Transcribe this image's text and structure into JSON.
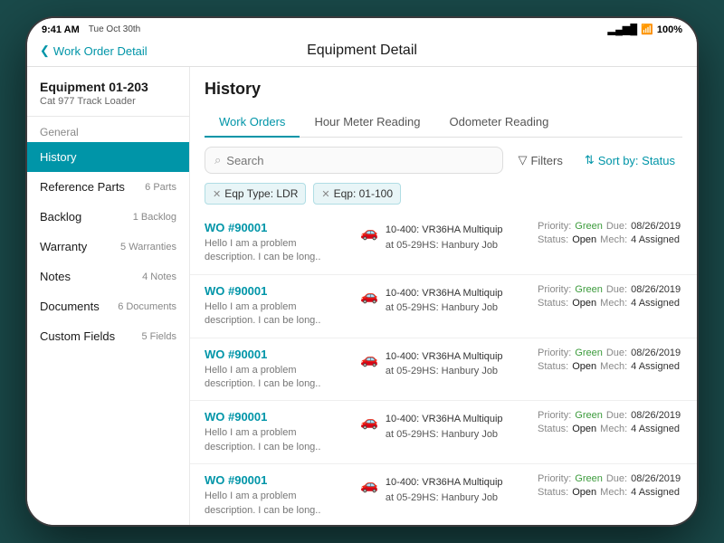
{
  "device": {
    "status_bar": {
      "time": "9:41 AM",
      "date": "Tue Oct 30th",
      "battery": "100%"
    },
    "nav": {
      "back_label": "Work Order Detail",
      "title": "Equipment Detail"
    }
  },
  "sidebar": {
    "equipment_id": "Equipment 01-203",
    "equipment_name": "Cat 977 Track Loader",
    "section_label": "General",
    "items": [
      {
        "id": "history",
        "label": "History",
        "badge": "",
        "active": true
      },
      {
        "id": "reference-parts",
        "label": "Reference Parts",
        "badge": "6 Parts",
        "active": false
      },
      {
        "id": "backlog",
        "label": "Backlog",
        "badge": "1 Backlog",
        "active": false
      },
      {
        "id": "warranty",
        "label": "Warranty",
        "badge": "5 Warranties",
        "active": false
      },
      {
        "id": "notes",
        "label": "Notes",
        "badge": "4 Notes",
        "active": false
      },
      {
        "id": "documents",
        "label": "Documents",
        "badge": "6 Documents",
        "active": false
      },
      {
        "id": "custom-fields",
        "label": "Custom Fields",
        "badge": "5 Fields",
        "active": false
      }
    ]
  },
  "content": {
    "title": "History",
    "tabs": [
      {
        "id": "work-orders",
        "label": "Work Orders",
        "active": true
      },
      {
        "id": "hour-meter",
        "label": "Hour Meter Reading",
        "active": false
      },
      {
        "id": "odometer",
        "label": "Odometer Reading",
        "active": false
      }
    ],
    "search_placeholder": "Search",
    "filter_label": "Filters",
    "sort_label": "Sort by: Status",
    "filter_chips": [
      {
        "id": "eqp-type",
        "label": "Eqp Type: LDR"
      },
      {
        "id": "eqp-num",
        "label": "Eqp: 01-100"
      }
    ],
    "work_orders": [
      {
        "id": "wo1",
        "number": "WO #90001",
        "description": "Hello I am a problem description. I can be long..",
        "equipment_name": "10-400: VR36HA Multiquip",
        "equipment_location": "at 05-29HS: Hanbury Job",
        "priority_label": "Priority:",
        "priority_value": "Green",
        "due_label": "Due:",
        "due_value": "08/26/2019",
        "status_label": "Status:",
        "status_value": "Open",
        "mech_label": "Mech:",
        "mech_value": "4 Assigned"
      },
      {
        "id": "wo2",
        "number": "WO #90001",
        "description": "Hello I am a problem description. I can be long..",
        "equipment_name": "10-400: VR36HA Multiquip",
        "equipment_location": "at 05-29HS: Hanbury Job",
        "priority_label": "Priority:",
        "priority_value": "Green",
        "due_label": "Due:",
        "due_value": "08/26/2019",
        "status_label": "Status:",
        "status_value": "Open",
        "mech_label": "Mech:",
        "mech_value": "4 Assigned"
      },
      {
        "id": "wo3",
        "number": "WO #90001",
        "description": "Hello I am a problem description. I can be long..",
        "equipment_name": "10-400: VR36HA Multiquip",
        "equipment_location": "at 05-29HS: Hanbury Job",
        "priority_label": "Priority:",
        "priority_value": "Green",
        "due_label": "Due:",
        "due_value": "08/26/2019",
        "status_label": "Status:",
        "status_value": "Open",
        "mech_label": "Mech:",
        "mech_value": "4 Assigned"
      },
      {
        "id": "wo4",
        "number": "WO #90001",
        "description": "Hello I am a problem description. I can be long..",
        "equipment_name": "10-400: VR36HA Multiquip",
        "equipment_location": "at 05-29HS: Hanbury Job",
        "priority_label": "Priority:",
        "priority_value": "Green",
        "due_label": "Due:",
        "due_value": "08/26/2019",
        "status_label": "Status:",
        "status_value": "Open",
        "mech_label": "Mech:",
        "mech_value": "4 Assigned"
      },
      {
        "id": "wo5",
        "number": "WO #90001",
        "description": "Hello I am a problem description. I can be long..",
        "equipment_name": "10-400: VR36HA Multiquip",
        "equipment_location": "at 05-29HS: Hanbury Job",
        "priority_label": "Priority:",
        "priority_value": "Green",
        "due_label": "Due:",
        "due_value": "08/26/2019",
        "status_label": "Status:",
        "status_value": "Open",
        "mech_label": "Mech:",
        "mech_value": "4 Assigned"
      }
    ]
  }
}
